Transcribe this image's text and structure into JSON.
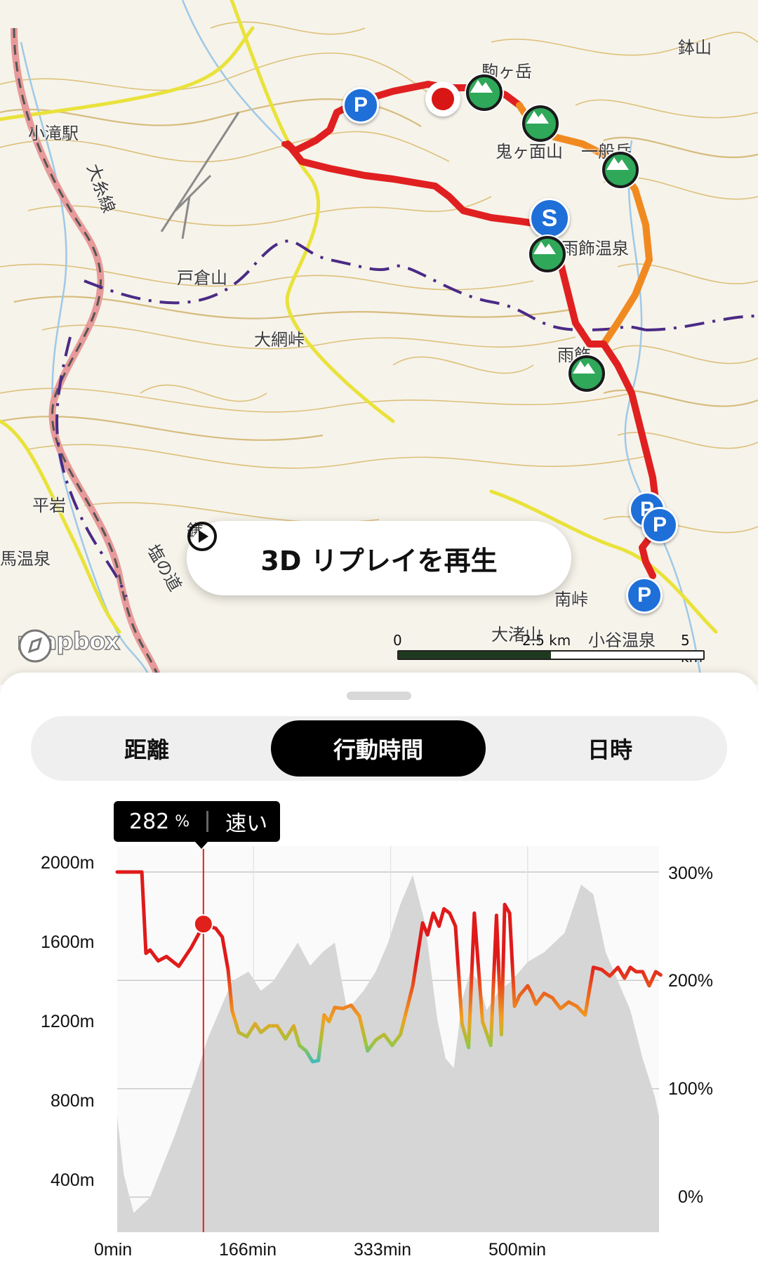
{
  "map": {
    "labels": {
      "komagatake": "駒ヶ岳",
      "onigamen": "鬼ヶ面山",
      "karagatake": "一般岳",
      "hachiyama": "鉢山",
      "amakazari_onsen": "雨飾温泉",
      "todakurayama": "戸倉山",
      "otsunatoge": "大網峠",
      "otari_station": "小滝駅",
      "ama": "雨飾",
      "itoigawa_line": "大糸線",
      "hiraiwa": "平岩",
      "uma_onsen": "馬温泉",
      "otani_onsen": "小谷温泉",
      "okiyama": "大渚山",
      "kamaboko": "鎌池",
      "nanba": "南峠",
      "tsuyama": "塩の道"
    },
    "start_marker": "S",
    "parking_marker": "P",
    "replay_label": "3D リプレイを再生",
    "attribution": "mapbox",
    "scale": {
      "ticks": [
        "0",
        "2.5 km",
        "5 km"
      ]
    }
  },
  "tabs": [
    {
      "label": "距離",
      "active": false
    },
    {
      "label": "行動時間",
      "active": true
    },
    {
      "label": "日時",
      "active": false
    }
  ],
  "tooltip": {
    "value": "282",
    "unit": "%",
    "status": "速い"
  },
  "chart_data": {
    "type": "line",
    "x_ticks": [
      "0min",
      "166min",
      "333min",
      "500min"
    ],
    "y_left_ticks": [
      "2000m",
      "1600m",
      "1200m",
      "800m",
      "400m"
    ],
    "y_right_ticks": [
      "300%",
      "200%",
      "100%",
      "0%"
    ],
    "x_range": [
      0,
      660
    ],
    "elevation_range": [
      200,
      2200
    ],
    "pace_range": [
      0,
      300
    ],
    "cursor_x": 105,
    "elevation": {
      "x": [
        0,
        8,
        20,
        40,
        70,
        95,
        110,
        125,
        140,
        160,
        175,
        190,
        205,
        220,
        235,
        250,
        265,
        280,
        300,
        315,
        330,
        345,
        360,
        375,
        390,
        400,
        410,
        420,
        430,
        440,
        450,
        465,
        480,
        500,
        520,
        545,
        565,
        580,
        595,
        610,
        625,
        640,
        655,
        660
      ],
      "y": [
        800,
        500,
        300,
        380,
        700,
        1000,
        1200,
        1350,
        1500,
        1550,
        1450,
        1500,
        1600,
        1700,
        1580,
        1650,
        1700,
        1350,
        1450,
        1550,
        1700,
        1900,
        2050,
        1800,
        1300,
        1100,
        1050,
        1400,
        1550,
        1500,
        1350,
        1450,
        1500,
        1600,
        1650,
        1750,
        2000,
        1950,
        1650,
        1500,
        1350,
        1100,
        900,
        800
      ]
    },
    "pace": {
      "x": [
        0,
        30,
        35,
        40,
        50,
        60,
        75,
        90,
        100,
        105,
        112,
        120,
        128,
        135,
        140,
        148,
        158,
        168,
        175,
        185,
        195,
        205,
        215,
        222,
        230,
        238,
        245,
        252,
        258,
        265,
        275,
        285,
        295,
        305,
        315,
        325,
        335,
        345,
        360,
        372,
        378,
        385,
        392,
        398,
        405,
        412,
        420,
        428,
        435,
        445,
        455,
        462,
        468,
        472,
        478,
        484,
        490,
        500,
        505,
        510,
        520,
        530,
        540,
        550,
        560,
        570,
        580,
        590,
        600,
        610,
        618,
        625,
        632,
        640,
        648,
        656,
        662
      ],
      "y": [
        300,
        300,
        225,
        228,
        218,
        222,
        213,
        230,
        244,
        252,
        250,
        248,
        240,
        210,
        172,
        152,
        148,
        160,
        152,
        158,
        158,
        146,
        158,
        140,
        135,
        125,
        126,
        168,
        162,
        175,
        174,
        177,
        167,
        135,
        145,
        150,
        140,
        150,
        195,
        253,
        242,
        262,
        250,
        266,
        262,
        250,
        160,
        138,
        262,
        162,
        140,
        260,
        150,
        270,
        262,
        176,
        186,
        195,
        188,
        178,
        188,
        184,
        174,
        180,
        176,
        168,
        212,
        210,
        204,
        212,
        202,
        212,
        208,
        208,
        195,
        208,
        205
      ]
    }
  }
}
